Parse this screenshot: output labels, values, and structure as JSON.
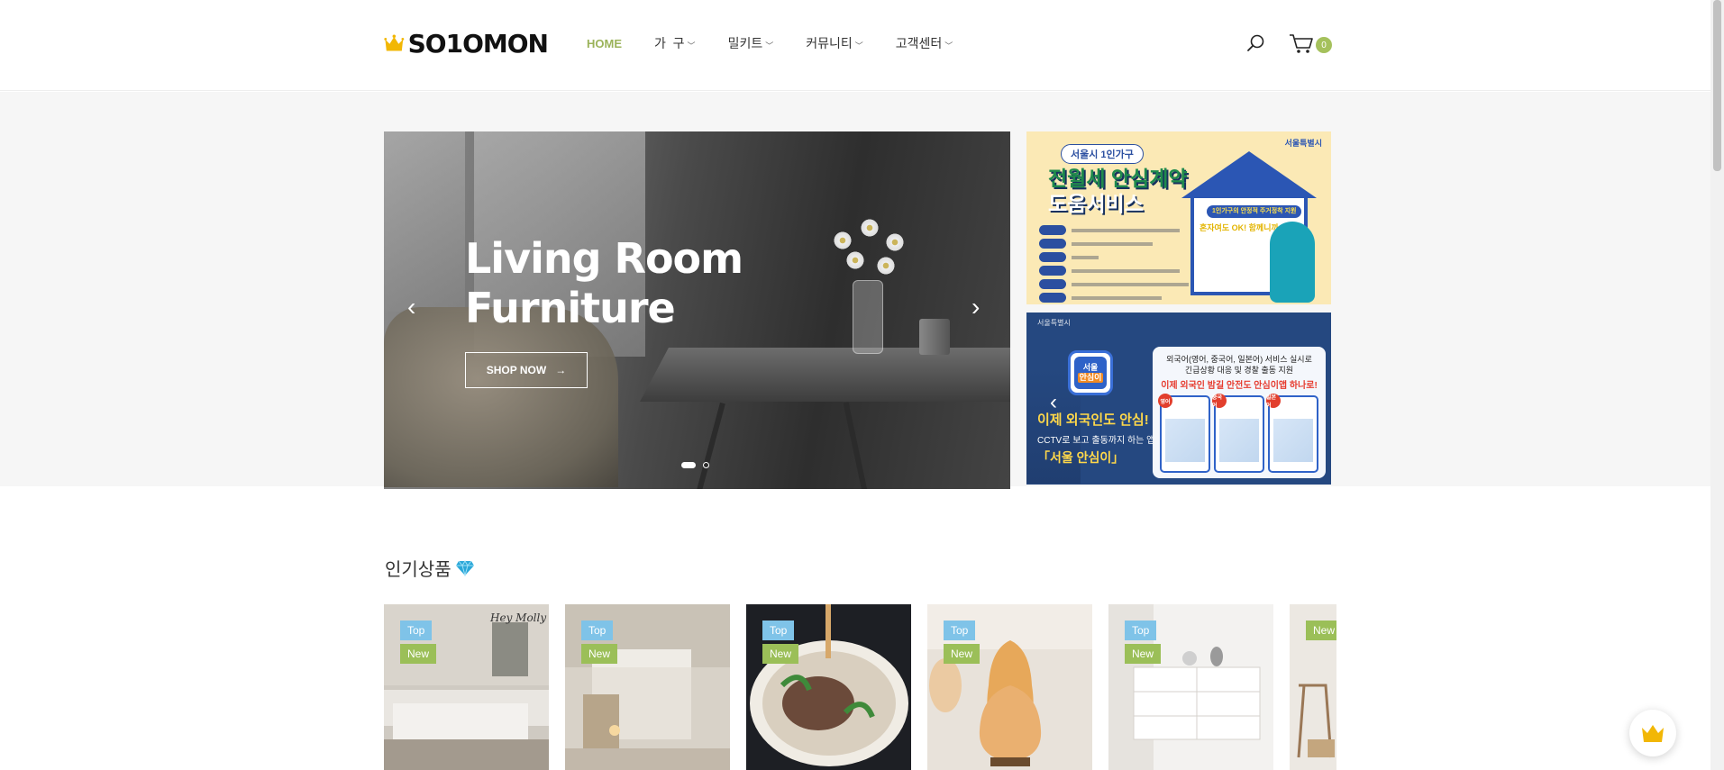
{
  "brand": {
    "logo_text": "SO1OMON"
  },
  "nav": {
    "items": [
      {
        "label": "HOME",
        "active": true,
        "has_dropdown": false
      },
      {
        "label": "가  구",
        "active": false,
        "has_dropdown": true
      },
      {
        "label": "밀키트",
        "active": false,
        "has_dropdown": true
      },
      {
        "label": "커뮤니티",
        "active": false,
        "has_dropdown": true
      },
      {
        "label": "고객센터",
        "active": false,
        "has_dropdown": true
      }
    ]
  },
  "header_actions": {
    "search_icon": "search-icon",
    "cart_icon": "cart-icon",
    "cart_count": "0"
  },
  "hero": {
    "title_line1": "Living Room",
    "title_line2": "Furniture",
    "button_label": "SHOP NOW",
    "button_arrow": "→",
    "prev_arrow": "‹",
    "next_arrow": "›",
    "slides_total": 2,
    "active_slide": 1
  },
  "banner1": {
    "tag": "서울시 1인가구",
    "title_line1": "전월세 안심계약",
    "title_line2": "도움서비스",
    "house_pill": "1인가구의 안정적 주거정착 지원",
    "house_ok_a": "혼자여도 OK!",
    "house_ok_b": "함께니까 OK!",
    "corner": "서울특별시"
  },
  "banner2": {
    "top_text": "서울특별시",
    "app_icon_l1": "서울",
    "app_icon_l2": "안심이",
    "main_text": "이제 외국인도 안심!",
    "sub_text": "CCTV로 보고 출동까지 하는 앱",
    "app_name": "「서울 안심이」",
    "card_line1": "외국어(영어, 중국어, 일본어) 서비스 실시로",
    "card_line2": "긴급상황 대응 및 경찰 출동 지원",
    "card_line3": "이제 외국인 밤길 안전도 안심이앱 하나로!",
    "phone_labels": [
      "영어",
      "중국어",
      "일본어"
    ],
    "prev_arrow": "‹",
    "next_arrow": "›"
  },
  "products_section": {
    "title": "인기상품",
    "title_icon": "gem-icon",
    "items": [
      {
        "badges": [
          "Top",
          "New"
        ],
        "image_label": "Hey Molly",
        "theme": "bedroom"
      },
      {
        "badges": [
          "Top",
          "New"
        ],
        "image_label": "",
        "theme": "loft"
      },
      {
        "badges": [
          "Top",
          "New"
        ],
        "image_label": "",
        "theme": "noodles"
      },
      {
        "badges": [
          "Top",
          "New"
        ],
        "image_label": "",
        "theme": "lamp"
      },
      {
        "badges": [
          "Top",
          "New"
        ],
        "image_label": "",
        "theme": "drawer"
      },
      {
        "badges": [
          "New"
        ],
        "image_label": "",
        "theme": "chair"
      }
    ]
  },
  "colors": {
    "accent": "#9bb35a",
    "badge_top": "#7fc3e8",
    "badge_new": "#9bbf58"
  }
}
